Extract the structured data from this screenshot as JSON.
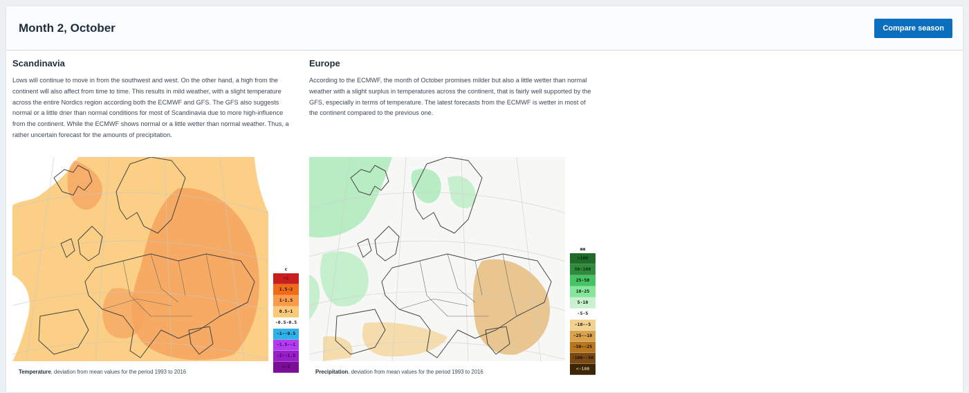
{
  "header": {
    "title": "Month 2, October",
    "compare_button": "Compare season"
  },
  "scandinavia": {
    "title": "Scandinavia",
    "body": "Lows will continue to move in from the southwest and west. On the other hand, a high from the continent will also affect from time to time. This results in mild weather, with a slight temperature across the entire Nordics region according both the ECMWF and GFS. The GFS also suggests normal or a little drier than normal conditions for most of Scandinavia due to more high-influence from the continent. While the ECMWF shows normal or a little wetter than normal weather. Thus, a rather uncertain forecast for the amounts of precipitation.",
    "caption_bold": "Temperature",
    "caption_rest": ", deviation from mean values for the period 1993 to 2016",
    "legend_unit": "c",
    "legend": [
      {
        "label": ">2",
        "color": "#c81e1e",
        "text": "#7a0b0b"
      },
      {
        "label": "1.5-2",
        "color": "#f06a18",
        "text": "#111111"
      },
      {
        "label": "1-1.5",
        "color": "#f89b4a",
        "text": "#111111"
      },
      {
        "label": "0.5-1",
        "color": "#fbc97a",
        "text": "#111111"
      },
      {
        "label": "-0.5-0.5",
        "color": "#ffffff",
        "text": "#111111"
      },
      {
        "label": "-1--0.5",
        "color": "#2fb2ea",
        "text": "#111111"
      },
      {
        "label": "-1.5--1",
        "color": "#b43cf0",
        "text": "#3a0050"
      },
      {
        "label": "-2--1.5",
        "color": "#9a1ec8",
        "text": "#3a0050"
      },
      {
        "label": "<-2",
        "color": "#7a0e96",
        "text": "#3a0050"
      }
    ]
  },
  "europe": {
    "title": "Europe",
    "body": "According to the ECMWF, the month of October promises milder but also a little wetter than normal weather with a slight surplus in temperatures across the continent, that is fairly well supported by the GFS, especially in terms of temperature. The latest forecasts from the ECMWF is wetter in most of the continent compared to the previous one.",
    "caption_bold": "Precipitation",
    "caption_rest": ", deviation from mean values for the period 1993 to 2016",
    "legend_unit": "mm",
    "legend": [
      {
        "label": ">100",
        "color": "#1f6b2a",
        "text": "#0a2a10"
      },
      {
        "label": "50-100",
        "color": "#2f8c3c",
        "text": "#0a2a10"
      },
      {
        "label": "25-50",
        "color": "#45c463",
        "text": "#111111"
      },
      {
        "label": "10-25",
        "color": "#85e69c",
        "text": "#111111"
      },
      {
        "label": "5-10",
        "color": "#c8f2cf",
        "text": "#111111"
      },
      {
        "label": "-5-5",
        "color": "#ffffff",
        "text": "#111111"
      },
      {
        "label": "-10--5",
        "color": "#f2d191",
        "text": "#111111"
      },
      {
        "label": "-25--10",
        "color": "#dba24c",
        "text": "#111111"
      },
      {
        "label": "-50--25",
        "color": "#b8761f",
        "text": "#111111"
      },
      {
        "label": "-100--50",
        "color": "#7a4a12",
        "text": "#111111"
      },
      {
        "label": "<-100",
        "color": "#3d2608",
        "text": "#c9b89a"
      }
    ]
  }
}
